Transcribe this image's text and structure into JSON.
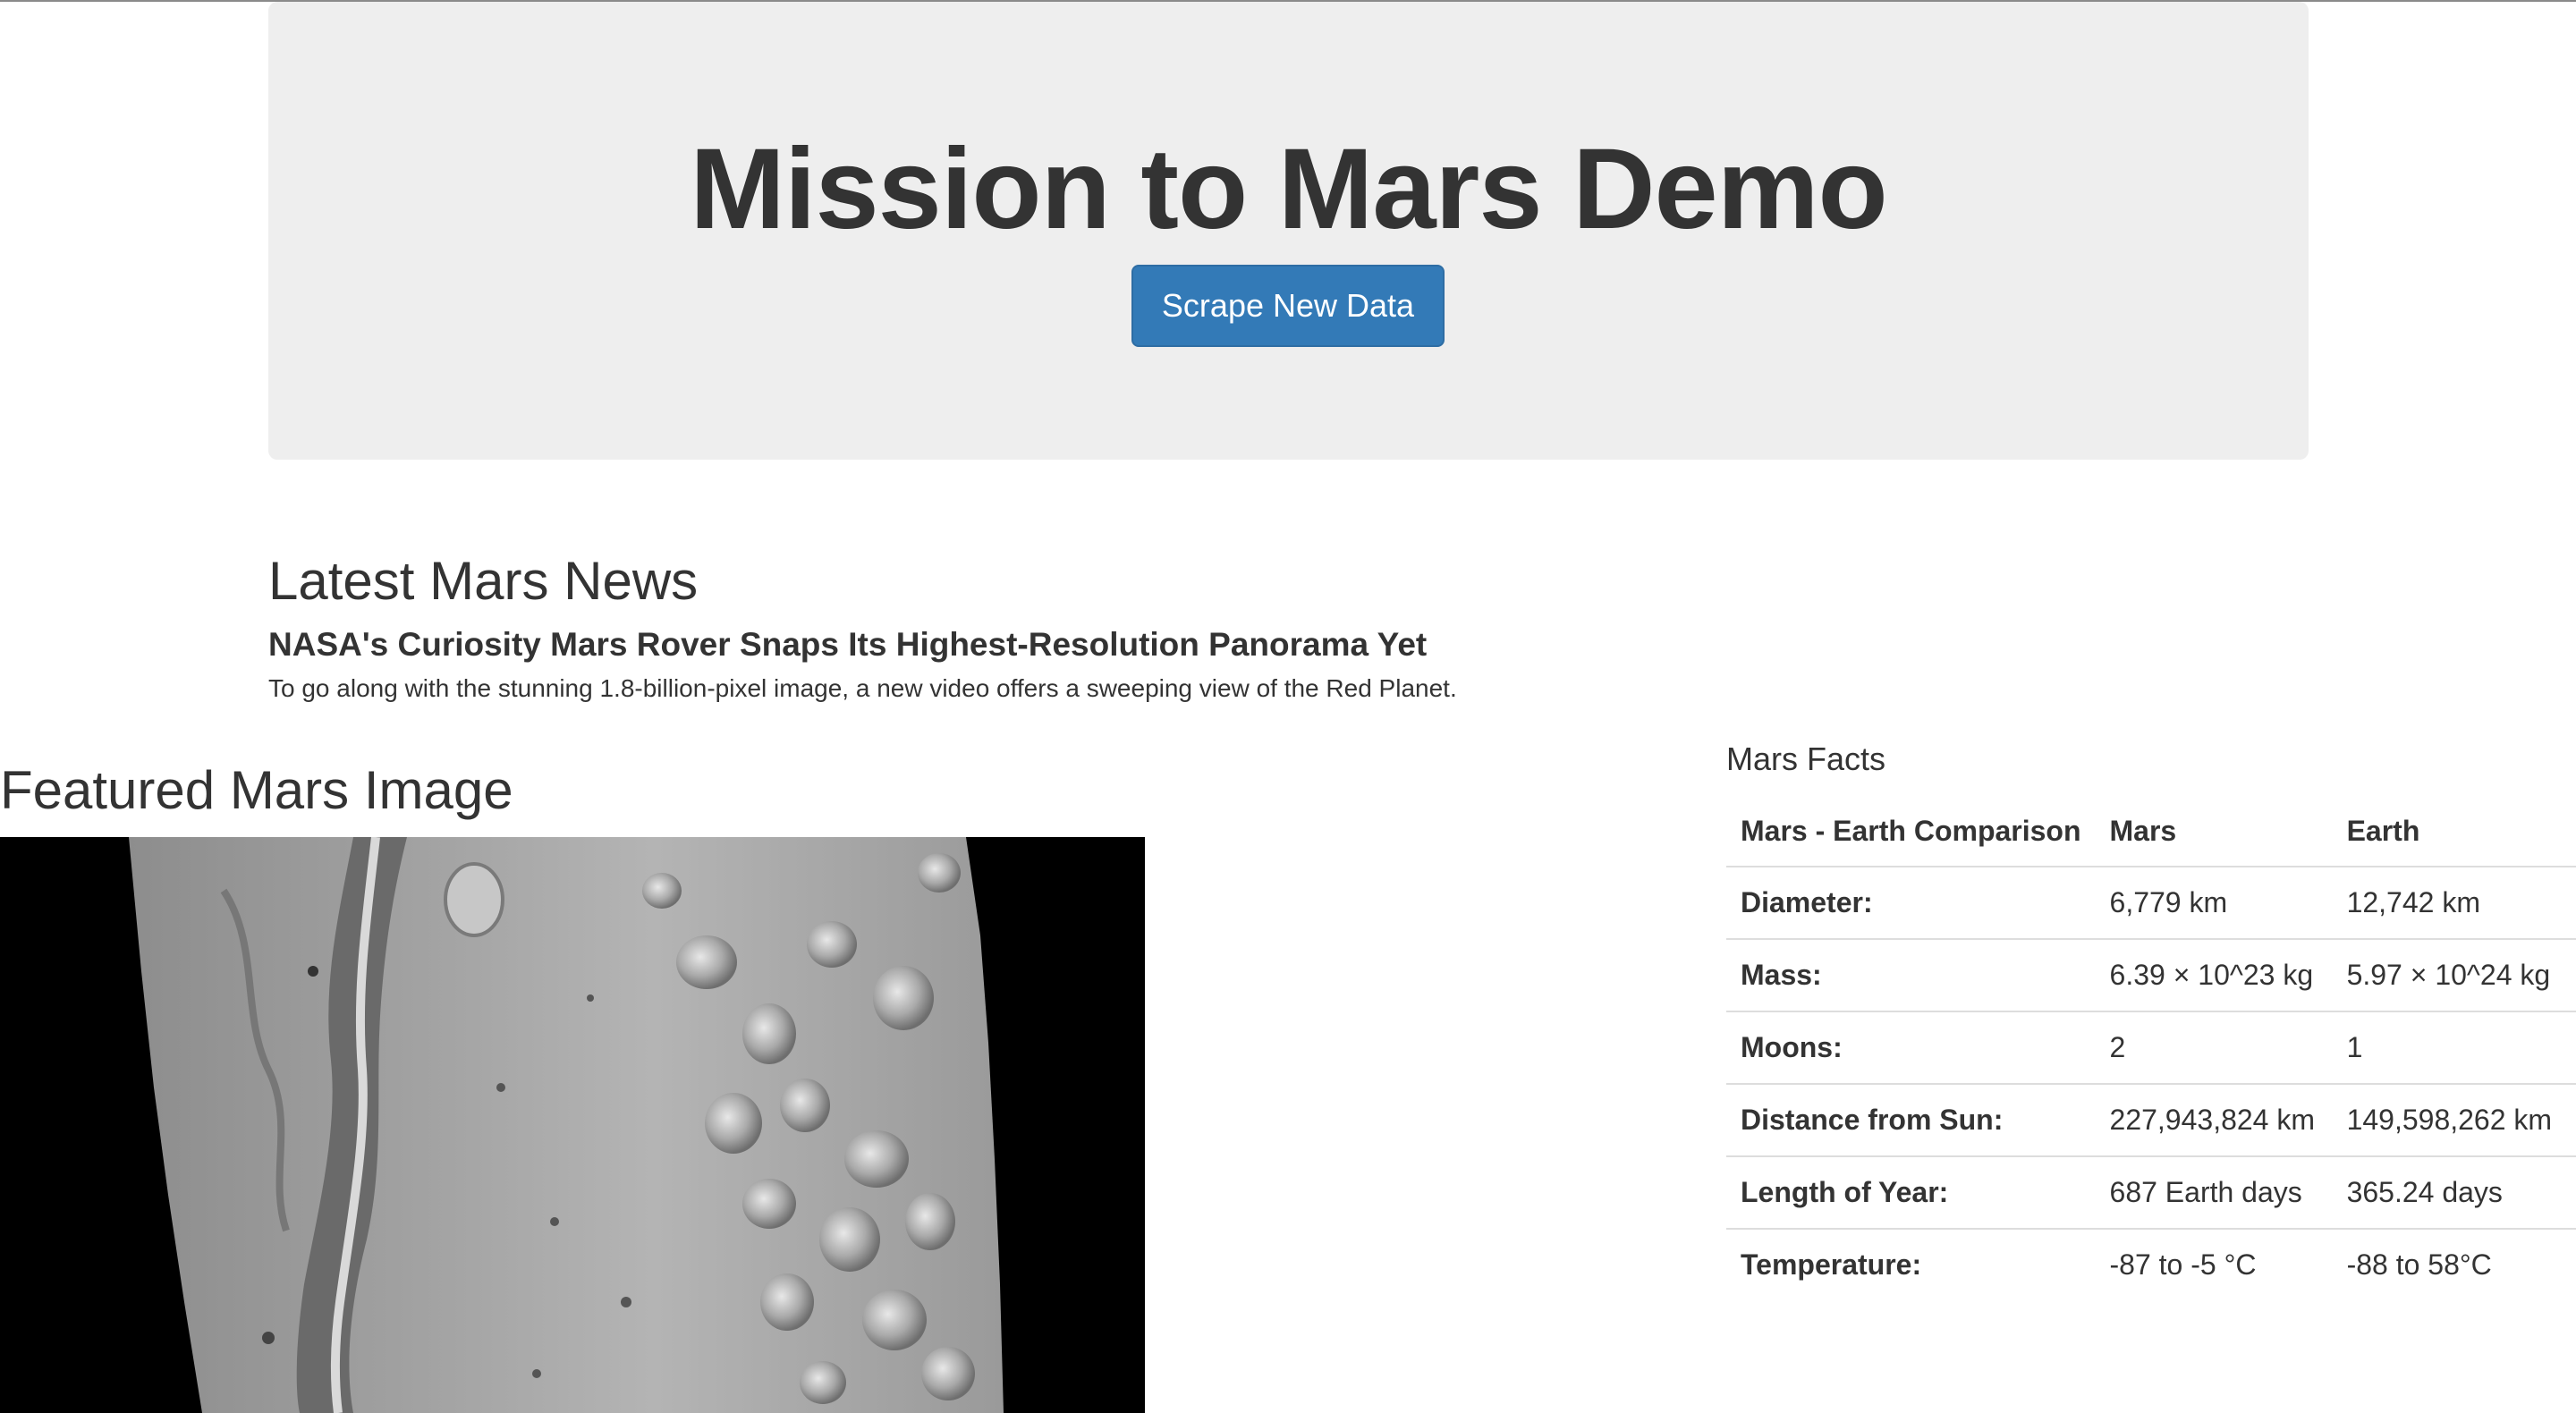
{
  "jumbotron": {
    "title": "Mission to Mars Demo",
    "button_label": "Scrape New Data",
    "button_color": "#337ab7"
  },
  "news": {
    "heading": "Latest Mars News",
    "title": "NASA's Curiosity Mars Rover Snaps Its Highest-Resolution Panorama Yet",
    "teaser": "To go along with the stunning 1.8-billion-pixel image, a new video offers a sweeping view of the Red Planet."
  },
  "featured": {
    "heading": "Featured Mars Image"
  },
  "facts": {
    "heading": "Mars Facts",
    "columns": [
      "Mars - Earth Comparison",
      "Mars",
      "Earth"
    ],
    "rows": [
      [
        "Diameter:",
        "6,779 km",
        "12,742 km"
      ],
      [
        "Mass:",
        "6.39 × 10^23 kg",
        "5.97 × 10^24 kg"
      ],
      [
        "Moons:",
        "2",
        "1"
      ],
      [
        "Distance from Sun:",
        "227,943,824 km",
        "149,598,262 km"
      ],
      [
        "Length of Year:",
        "687 Earth days",
        "365.24 days"
      ],
      [
        "Temperature:",
        "-87 to -5 °C",
        "-88 to 58°C"
      ]
    ]
  }
}
